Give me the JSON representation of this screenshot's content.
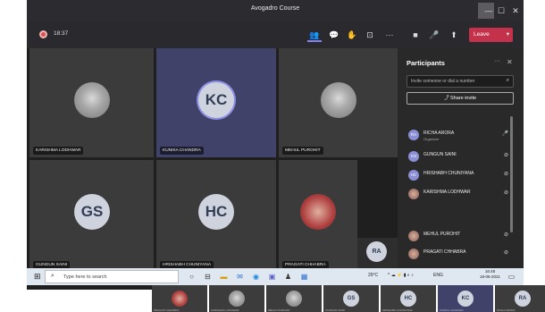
{
  "window": {
    "title": "Avogadro Course",
    "minimize": "—",
    "maximize": "☐",
    "close": "✕"
  },
  "toolbar": {
    "timer": "18:37",
    "leave_label": "Leave",
    "icons": {
      "participants": "👥",
      "chat": "💬",
      "raise_hand": "✋",
      "share": "⊡",
      "more": "···",
      "camera": "■",
      "mic": "🎤",
      "share_tray": "⬆",
      "leave_chevron": "▾"
    }
  },
  "tiles": [
    {
      "name": "KARISHMA LODHWAR",
      "avatar_type": "photo",
      "initials": ""
    },
    {
      "name": "KUNIKA CHANDRA",
      "avatar_type": "initials",
      "initials": "KC"
    },
    {
      "name": "MEHUL PUROHIT",
      "avatar_type": "photo",
      "initials": ""
    },
    {
      "name": "GUNGUN SAINI",
      "avatar_type": "initials",
      "initials": "GS"
    },
    {
      "name": "HRISHABH CHUNIYANA",
      "avatar_type": "initials",
      "initials": "HC"
    },
    {
      "name": "PRAGATI CHHABRA",
      "avatar_type": "photo",
      "initials": ""
    }
  ],
  "self_view": {
    "initials": "RA"
  },
  "participants": {
    "title": "Participants",
    "more": "···",
    "close": "✕",
    "invite_placeholder": "Invite someone or dial a number",
    "share_invite": "Share invite",
    "items": [
      {
        "name": "RICHA ARORA",
        "role": "Organizer",
        "initials": "RA",
        "photo": false
      },
      {
        "name": "GUNGUN SAINI",
        "role": "",
        "initials": "GS",
        "photo": false
      },
      {
        "name": "HRISHABH CHUNIYANA",
        "role": "",
        "initials": "HC",
        "photo": false
      },
      {
        "name": "KARISHMA LODHWAR",
        "role": "",
        "initials": "",
        "photo": true
      },
      {
        "name": "MEHUL PUROHIT",
        "role": "",
        "initials": "",
        "photo": true
      },
      {
        "name": "PRAGATI CHHABRA",
        "role": "",
        "initials": "",
        "photo": true
      }
    ]
  },
  "taskbar": {
    "search_placeholder": "Type here to search",
    "weather": "29°C",
    "language": "ENG",
    "time": "16:48",
    "date": "18-06-2021"
  },
  "strip": [
    {
      "name": "PRAGATI CHHABRA",
      "initials": "",
      "photo": true
    },
    {
      "name": "KARISHMA LODHWAR",
      "initials": "",
      "photo": true
    },
    {
      "name": "MEHUL PUROHIT",
      "initials": "",
      "photo": true
    },
    {
      "name": "GUNGUN SAINI",
      "initials": "GS",
      "photo": false
    },
    {
      "name": "HRISHABH CHUNIYANA",
      "initials": "HC",
      "photo": false
    },
    {
      "name": "KUNIKA CHANDRA",
      "initials": "KC",
      "photo": false
    },
    {
      "name": "RICHA ARORA",
      "initials": "RA",
      "photo": false
    }
  ]
}
